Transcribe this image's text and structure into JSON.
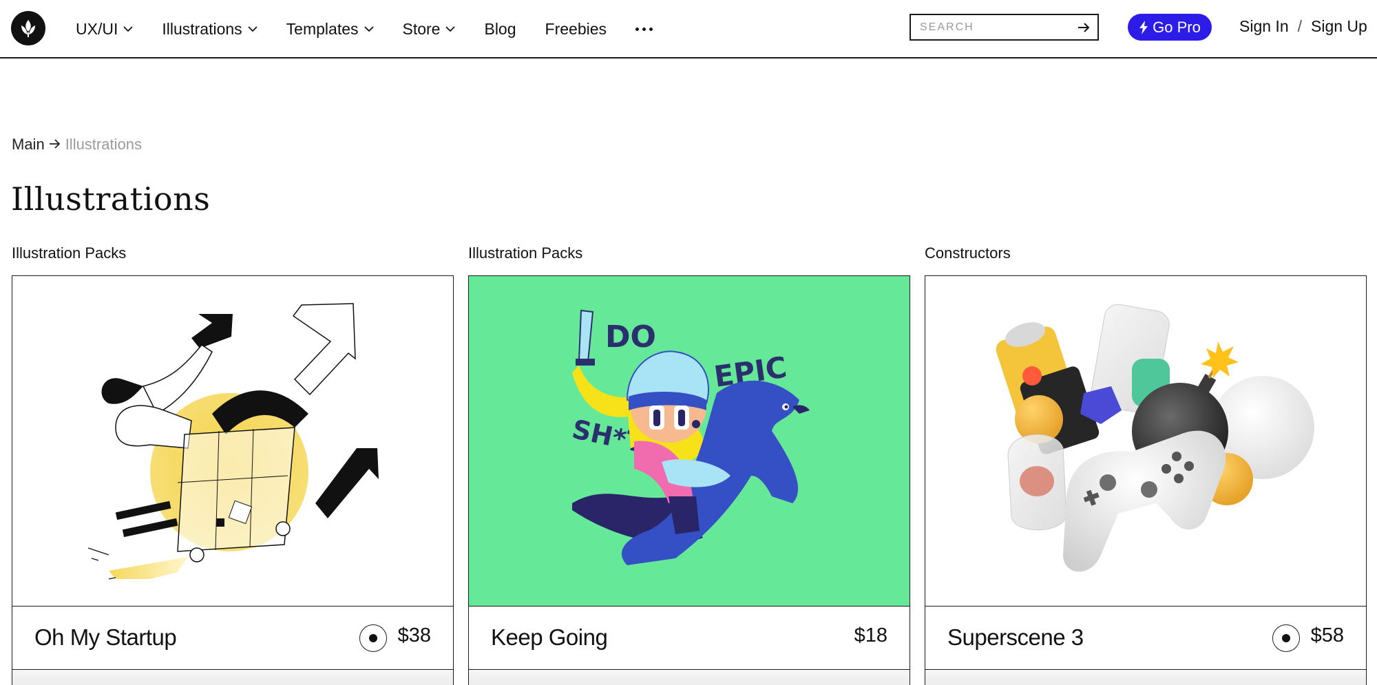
{
  "header": {
    "logo": "leaf-logo-icon",
    "nav": [
      {
        "label": "UX/UI",
        "has_dropdown": true
      },
      {
        "label": "Illustrations",
        "has_dropdown": true
      },
      {
        "label": "Templates",
        "has_dropdown": true
      },
      {
        "label": "Store",
        "has_dropdown": true
      },
      {
        "label": "Blog",
        "has_dropdown": false
      },
      {
        "label": "Freebies",
        "has_dropdown": false
      }
    ],
    "more_icon": "ellipsis-icon",
    "search": {
      "placeholder": "SEARCH",
      "value": ""
    },
    "go_pro_label": "Go Pro",
    "sign_in_label": "Sign In",
    "auth_separator": "/",
    "sign_up_label": "Sign Up"
  },
  "breadcrumb": {
    "main": "Main",
    "current": "Illustrations"
  },
  "page_title": "Illustrations",
  "colors": {
    "accent": "#2d1ce8",
    "card2_bg": "#66e899",
    "border": "#1a1a1a",
    "muted_text": "#9b9b9b"
  },
  "cards": [
    {
      "category": "Illustration Packs",
      "name": "Oh My Startup",
      "price": "$38",
      "has_badge": true
    },
    {
      "category": "Illustration Packs",
      "name": "Keep Going",
      "price": "$18",
      "has_badge": false
    },
    {
      "category": "Constructors",
      "name": "Superscene 3",
      "price": "$58",
      "has_badge": true
    }
  ],
  "card2_art_text": {
    "do": "DO",
    "epic": "EPIC",
    "sht": "SH*T"
  }
}
